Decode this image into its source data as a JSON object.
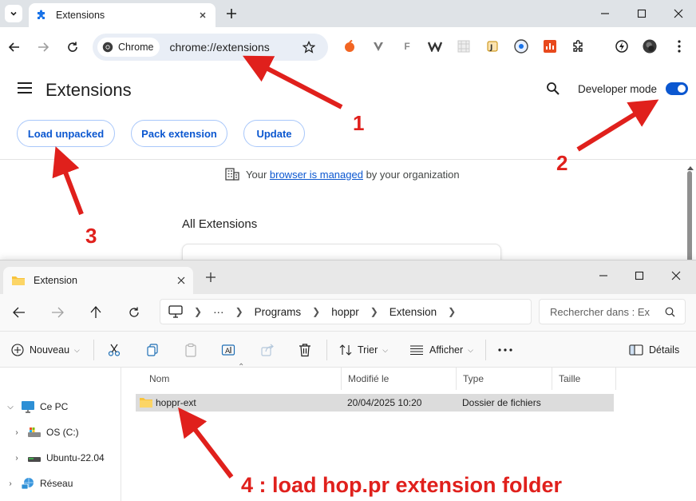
{
  "chrome": {
    "tab_title": "Extensions",
    "chip_label": "Chrome",
    "url": "chrome://extensions",
    "page_title": "Extensions",
    "developer_mode_label": "Developer mode",
    "developer_mode_on": true,
    "buttons": {
      "load_unpacked": "Load unpacked",
      "pack_extension": "Pack extension",
      "update": "Update"
    },
    "managed": {
      "prefix": "Your ",
      "link": "browser is managed",
      "suffix": " by your organization"
    },
    "section_title": "All Extensions",
    "accent": "#0b57d0"
  },
  "explorer": {
    "tab_title": "Extension",
    "breadcrumb": [
      "Programs",
      "hoppr",
      "Extension"
    ],
    "breadcrumb_ellipsis": "···",
    "search_placeholder": "Rechercher dans : Ex",
    "commands": {
      "new": "Nouveau",
      "sort": "Trier",
      "view": "Afficher",
      "details": "Détails"
    },
    "tree": {
      "this_pc": "Ce PC",
      "os_drive": "OS (C:)",
      "ubuntu": "Ubuntu-22.04",
      "network": "Réseau"
    },
    "columns": {
      "name": "Nom",
      "modified": "Modifié le",
      "type": "Type",
      "size": "Taille"
    },
    "rows": [
      {
        "name": "hoppr-ext",
        "modified": "20/04/2025 10:20",
        "type": "Dossier de fichiers",
        "size": ""
      }
    ]
  },
  "annotations": {
    "step1": "1",
    "step2": "2",
    "step3": "3",
    "step4": "4 : load hop.pr extension folder",
    "color": "#e0201c"
  }
}
